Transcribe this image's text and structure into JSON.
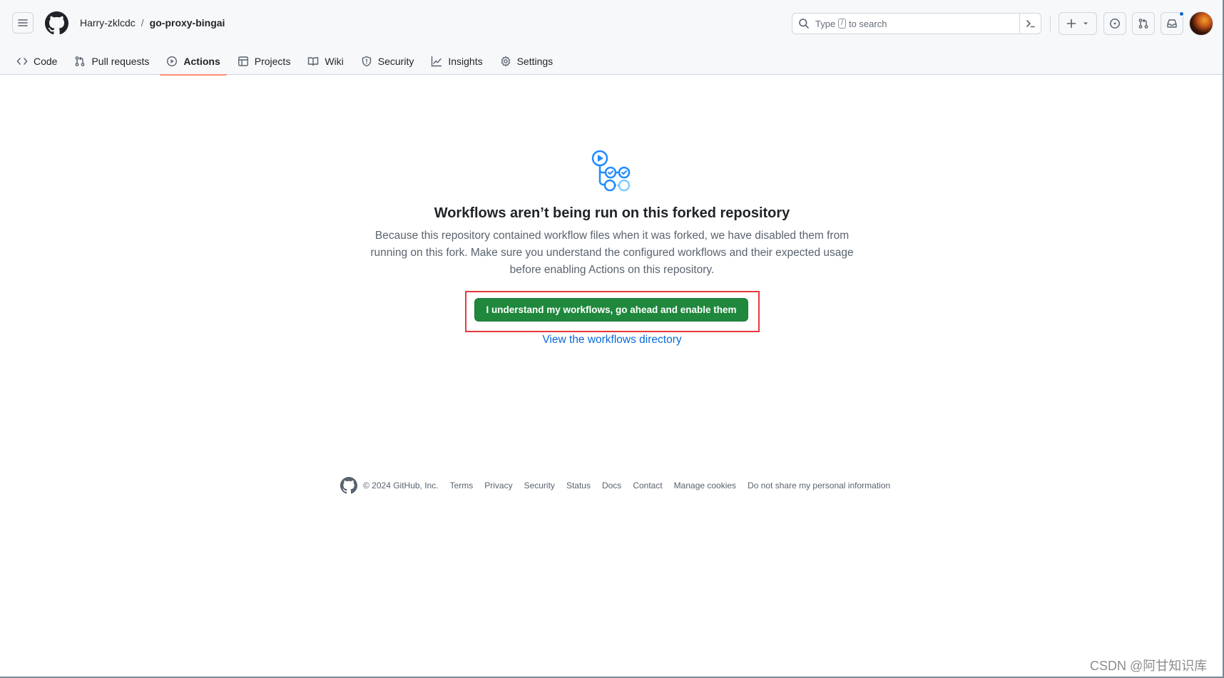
{
  "header": {
    "breadcrumb": {
      "owner": "Harry-zklcdc",
      "separator": "/",
      "repo": "go-proxy-bingai"
    },
    "search": {
      "before_kbd": "Type",
      "kbd": "/",
      "after_kbd": "to search"
    },
    "icons": {
      "menu": "hamburger-icon",
      "logo": "github-mark-icon",
      "search": "search-icon",
      "command": "command-palette-icon",
      "create": "plus-icon",
      "dropdown": "triangle-down-icon",
      "issues": "issue-opened-icon",
      "pulls": "git-pull-request-icon",
      "inbox": "inbox-icon"
    },
    "colors": {
      "notification_dot": "#0969da"
    }
  },
  "tabs": [
    {
      "label": "Code",
      "icon": "code-icon"
    },
    {
      "label": "Pull requests",
      "icon": "git-pull-request-icon"
    },
    {
      "label": "Actions",
      "icon": "play-icon",
      "active": true
    },
    {
      "label": "Projects",
      "icon": "table-icon"
    },
    {
      "label": "Wiki",
      "icon": "book-icon"
    },
    {
      "label": "Security",
      "icon": "shield-icon"
    },
    {
      "label": "Insights",
      "icon": "graph-icon"
    },
    {
      "label": "Settings",
      "icon": "gear-icon"
    }
  ],
  "main": {
    "icon": "workflow-icon",
    "title": "Workflows aren’t being run on this forked repository",
    "description": "Because this repository contained workflow files when it was forked, we have disabled them from running on this fork. Make sure you understand the configured workflows and their expected usage before enabling Actions on this repository.",
    "enable_button": "I understand my workflows, go ahead and enable them",
    "directory_link": "View the workflows directory",
    "colors": {
      "button": "#1f883d",
      "link": "#0969da",
      "highlight": "#e5383b"
    }
  },
  "footer": {
    "copyright": "© 2024 GitHub, Inc.",
    "links": [
      "Terms",
      "Privacy",
      "Security",
      "Status",
      "Docs",
      "Contact",
      "Manage cookies",
      "Do not share my personal information"
    ]
  },
  "watermark": "CSDN @阿甘知识库"
}
